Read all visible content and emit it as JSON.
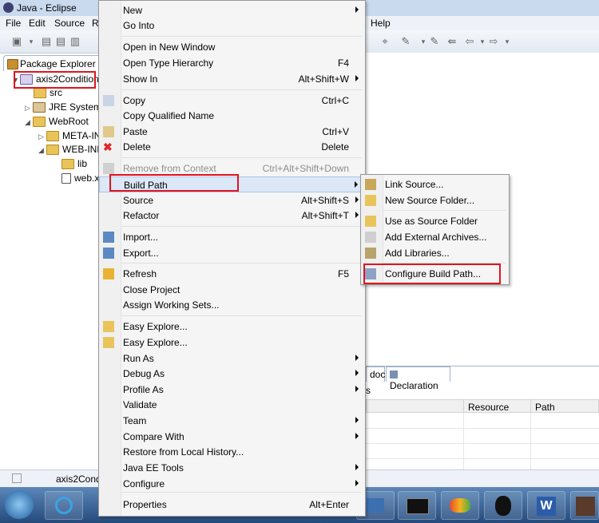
{
  "window": {
    "title": "Java - Eclipse"
  },
  "menubar": {
    "items": [
      "File",
      "Edit",
      "Source",
      "R",
      "Help"
    ]
  },
  "package_explorer": {
    "tab_label": "Package Explorer",
    "tree": [
      {
        "label": "axis2Condition"
      },
      {
        "label": "src"
      },
      {
        "label": "JRE System"
      },
      {
        "label": "WebRoot"
      },
      {
        "label": "META-IN"
      },
      {
        "label": "WEB-INF"
      },
      {
        "label": "lib"
      },
      {
        "label": "web.x"
      }
    ]
  },
  "context_menu": {
    "items": [
      {
        "label": "New",
        "shortcut": "",
        "submenu": true
      },
      {
        "label": "Go Into",
        "shortcut": ""
      },
      {
        "label": "Open in New Window",
        "shortcut": ""
      },
      {
        "label": "Open Type Hierarchy",
        "shortcut": "F4"
      },
      {
        "label": "Show In",
        "shortcut": "Alt+Shift+W",
        "submenu": true
      },
      {
        "label": "Copy",
        "shortcut": "Ctrl+C"
      },
      {
        "label": "Copy Qualified Name",
        "shortcut": ""
      },
      {
        "label": "Paste",
        "shortcut": "Ctrl+V"
      },
      {
        "label": "Delete",
        "shortcut": "Delete"
      },
      {
        "label": "Remove from Context",
        "shortcut": "Ctrl+Alt+Shift+Down",
        "disabled": true
      },
      {
        "label": "Build Path",
        "shortcut": "",
        "submenu": true,
        "highlighted": true
      },
      {
        "label": "Source",
        "shortcut": "Alt+Shift+S",
        "submenu": true
      },
      {
        "label": "Refactor",
        "shortcut": "Alt+Shift+T",
        "submenu": true
      },
      {
        "label": "Import...",
        "shortcut": ""
      },
      {
        "label": "Export...",
        "shortcut": ""
      },
      {
        "label": "Refresh",
        "shortcut": "F5"
      },
      {
        "label": "Close Project",
        "shortcut": ""
      },
      {
        "label": "Assign Working Sets...",
        "shortcut": ""
      },
      {
        "label": "Easy Explore...",
        "shortcut": ""
      },
      {
        "label": "Easy Explore...",
        "shortcut": ""
      },
      {
        "label": "Run As",
        "shortcut": "",
        "submenu": true
      },
      {
        "label": "Debug As",
        "shortcut": "",
        "submenu": true
      },
      {
        "label": "Profile As",
        "shortcut": "",
        "submenu": true
      },
      {
        "label": "Validate",
        "shortcut": ""
      },
      {
        "label": "Team",
        "shortcut": "",
        "submenu": true
      },
      {
        "label": "Compare With",
        "shortcut": "",
        "submenu": true
      },
      {
        "label": "Restore from Local History...",
        "shortcut": ""
      },
      {
        "label": "Java EE Tools",
        "shortcut": "",
        "submenu": true
      },
      {
        "label": "Configure",
        "shortcut": "",
        "submenu": true
      },
      {
        "label": "Properties",
        "shortcut": "Alt+Enter"
      }
    ]
  },
  "build_path_submenu": {
    "items": [
      {
        "label": "Link Source..."
      },
      {
        "label": "New Source Folder..."
      },
      {
        "label": "Use as Source Folder"
      },
      {
        "label": "Add External Archives..."
      },
      {
        "label": "Add Libraries..."
      },
      {
        "label": "Configure Build Path..."
      }
    ]
  },
  "bottom_pane": {
    "tabs": [
      "doc",
      "Declaration"
    ],
    "partial_text": "s",
    "columns": [
      "Resource",
      "Path"
    ]
  },
  "status_bar": {
    "text": "axis2Condi"
  },
  "colors": {
    "highlight_box": "#e0141e",
    "menu_hover": "#dce7f7"
  }
}
